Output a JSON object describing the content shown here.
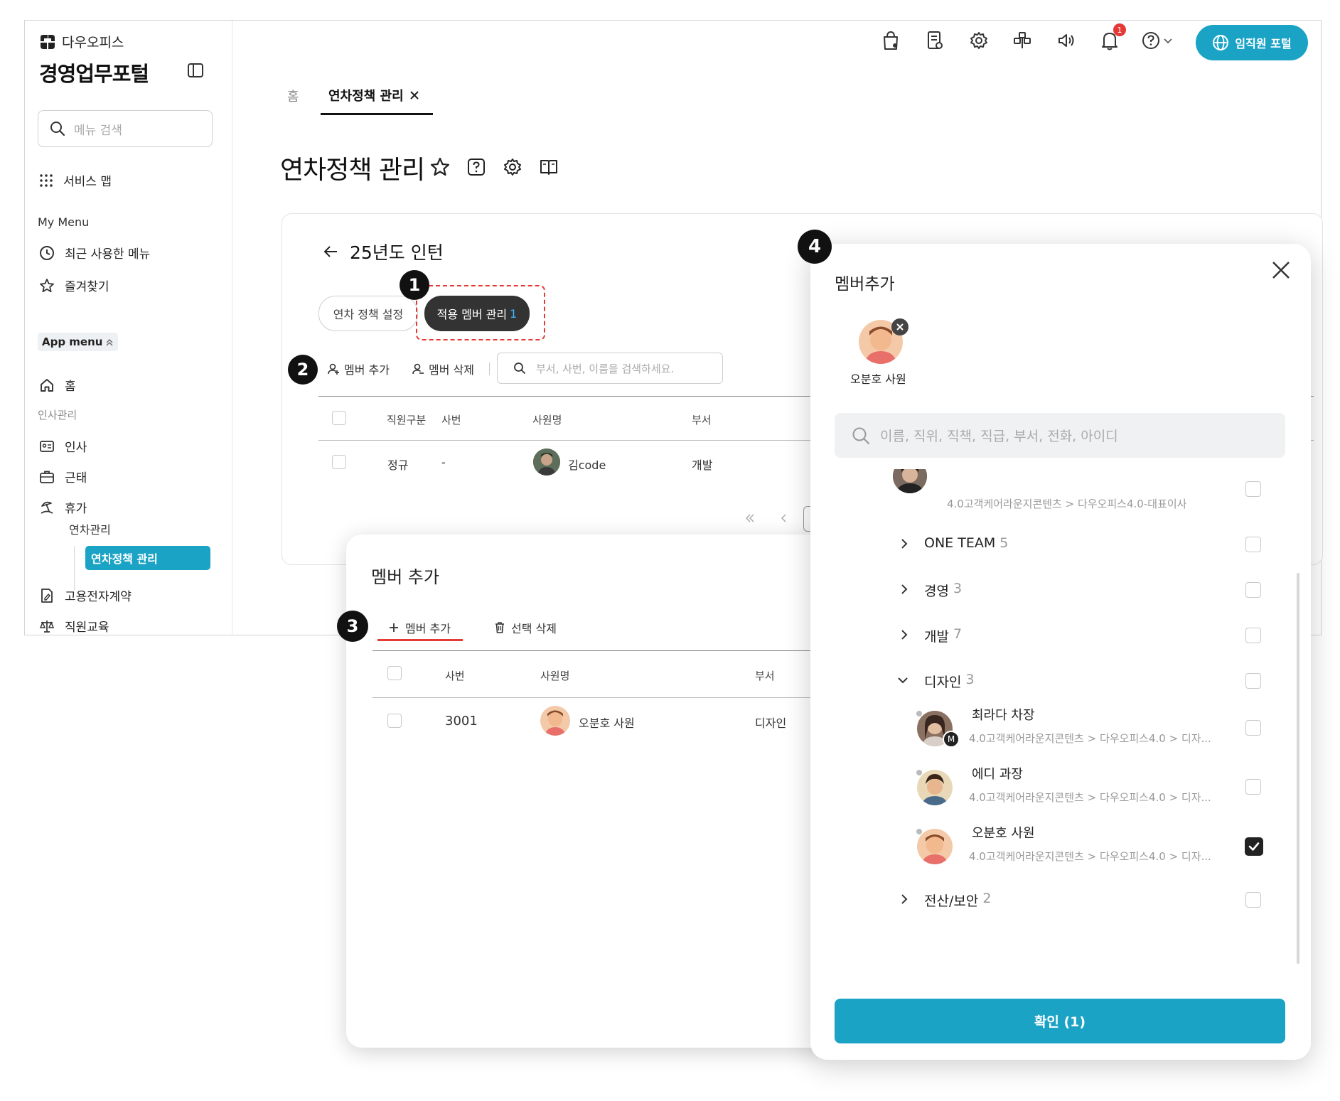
{
  "brand": {
    "company": "다우오피스",
    "portal": "경영업무포털"
  },
  "sidebar": {
    "search_placeholder": "메뉴 검색",
    "service_map": "서비스 맵",
    "my_menu_header": "My Menu",
    "recent": "최근 사용한 메뉴",
    "favorites": "즐겨찾기",
    "app_menu": "App menu",
    "home": "홈",
    "hr_header": "인사관리",
    "items": [
      "인사",
      "근태",
      "휴가"
    ],
    "leave_sub": "연차관리",
    "active_item": "연차정책 관리",
    "contract": "고용전자계약",
    "training": "직원교육"
  },
  "topbar": {
    "icons": [
      "shopping-bag-icon",
      "document-icon",
      "gear-icon",
      "network-icon",
      "speaker-icon",
      "bell-icon",
      "help-icon"
    ],
    "notification_count": "1",
    "portal_button": "임직원 포털"
  },
  "tabs": {
    "home": "홈",
    "current": "연차정책 관리"
  },
  "page": {
    "title": "연차정책 관리"
  },
  "policy": {
    "title": "25년도 인턴",
    "tab_settings": "연차 정책 설정",
    "tab_members": "적용 멤버 관리",
    "tab_members_count": "1",
    "add_member": "멤버 추가",
    "delete_member": "멤버 삭제",
    "search_placeholder": "부서, 사번, 이름을 검색하세요.",
    "columns": [
      "직원구분",
      "사번",
      "사원명",
      "부서"
    ],
    "rows": [
      {
        "type": "정규",
        "id": "-",
        "name": "김code",
        "dept": "개발"
      }
    ]
  },
  "markers": [
    "1",
    "2",
    "3",
    "4"
  ],
  "add_panel": {
    "title": "멤버 추가",
    "add": "멤버 추가",
    "delete_selected": "선택 삭제",
    "columns": [
      "사번",
      "사원명",
      "부서"
    ],
    "rows": [
      {
        "id": "3001",
        "name": "오분호 사원",
        "dept": "디자인"
      }
    ]
  },
  "modal": {
    "title": "멤버추가",
    "selected": [
      "오분호 사원"
    ],
    "search_placeholder": "이름, 직위, 직책, 직급, 부서, 전화, 아이디",
    "top_partial_path": "4.0고객케어라운지콘텐츠 > 다우오피스4.0-대표이사",
    "groups": [
      {
        "name": "ONE TEAM",
        "count": "5"
      },
      {
        "name": "경영",
        "count": "3"
      },
      {
        "name": "개발",
        "count": "7"
      },
      {
        "name": "디자인",
        "count": "3"
      },
      {
        "name": "전산/보안",
        "count": "2"
      }
    ],
    "people": [
      {
        "name": "최라다 차장",
        "path": "4.0고객케어라운지콘텐츠 > 다우오피스4.0 > 디자...",
        "badge": "M",
        "checked": false
      },
      {
        "name": "에디 과장",
        "path": "4.0고객케어라운지콘텐츠 > 다우오피스4.0 > 디자...",
        "checked": false
      },
      {
        "name": "오분호 사원",
        "path": "4.0고객케어라운지콘텐츠 > 다우오피스4.0 > 디자...",
        "checked": true
      }
    ],
    "confirm": "확인 (1)"
  },
  "colors": {
    "accent": "#1ba3c6",
    "highlight": "#e53935",
    "dark_pill": "#333333"
  }
}
